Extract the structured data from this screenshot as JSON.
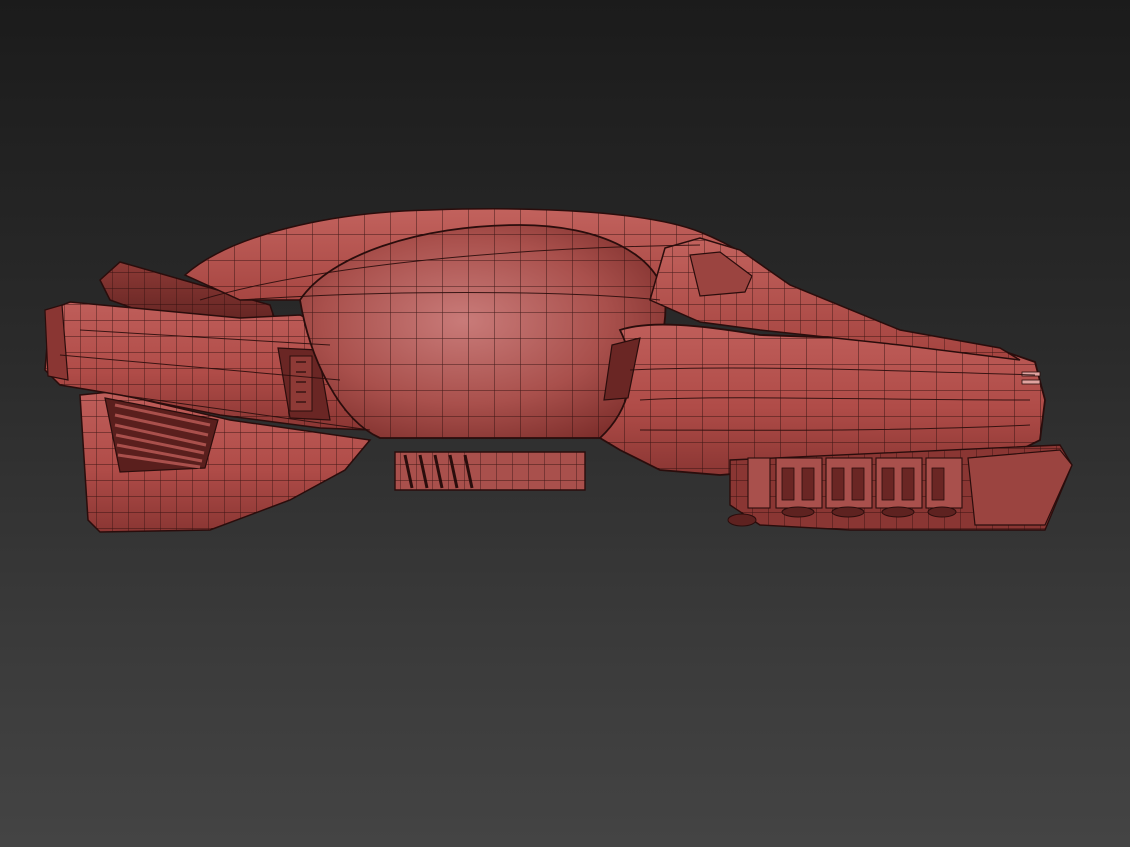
{
  "viewport": {
    "background_top": "#1b1b1b",
    "background_bottom": "#444444",
    "display_mode": "shaded-with-wireframe"
  },
  "model": {
    "kind": "spaceship-hull",
    "shade_color": "#b7504b",
    "shade_dark": "#7e2f2c",
    "shade_highlight": "#c97b79",
    "wire_color": "#2a0d0c"
  }
}
